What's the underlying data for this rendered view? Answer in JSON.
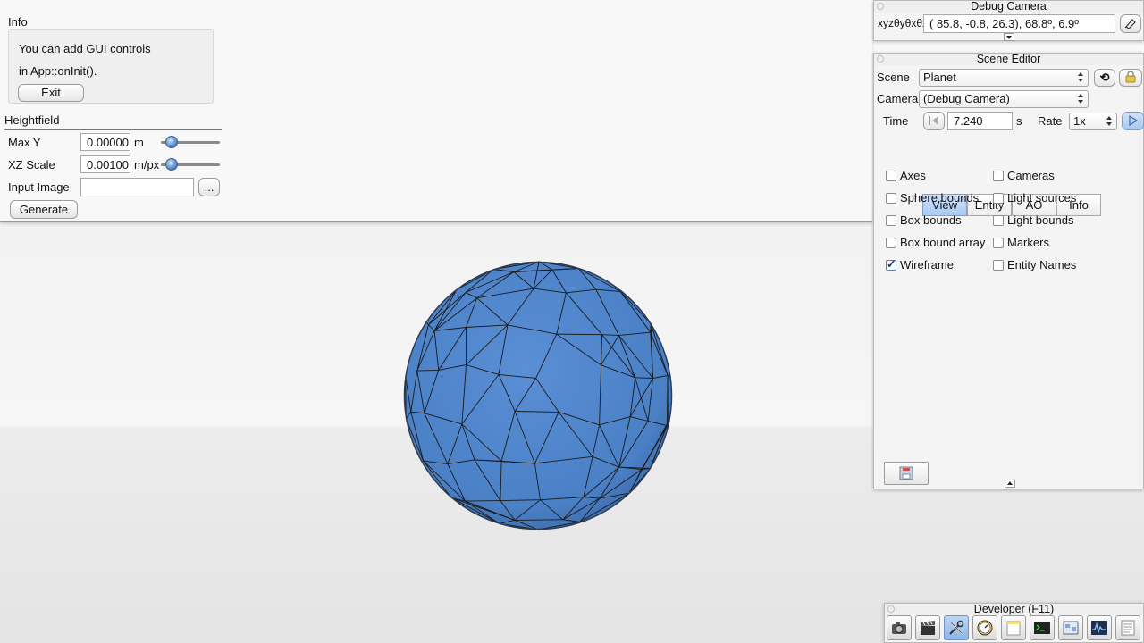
{
  "info_panel": {
    "title": "Info",
    "line1": "You can add GUI controls",
    "line2": "in App::onInit().",
    "exit_label": "Exit"
  },
  "heightfield": {
    "title": "Heightfield",
    "max_y_label": "Max Y",
    "max_y_value": "0.00000",
    "max_y_unit": "m",
    "max_y_slider_value": 0.1,
    "xz_scale_label": "XZ Scale",
    "xz_scale_value": "0.00100",
    "xz_scale_unit": "m/px",
    "xz_scale_slider_value": 0.1,
    "input_image_label": "Input Image",
    "input_image_value": "",
    "browse_label": "...",
    "generate_label": "Generate"
  },
  "debug_camera": {
    "title": "Debug Camera",
    "xyz_label": "xyzθyθxθz",
    "value": "( 85.8,  -0.8,  26.3),  68.8º,   6.9º",
    "copy_icon": "copy-icon",
    "expand_icon": "chevron-down-icon"
  },
  "scene_editor": {
    "title": "Scene Editor",
    "scene_label": "Scene",
    "scene_value": "Planet",
    "reload_icon": "reload-icon",
    "lock_icon": "lock-icon",
    "camera_label": "Camera",
    "camera_value": "(Debug Camera)",
    "time_label": "Time",
    "time_value": "7.240",
    "time_unit": "s",
    "rate_label": "Rate",
    "rate_value": "1x",
    "play_icon": "play-icon",
    "tabs": [
      {
        "label": "View",
        "active": true
      },
      {
        "label": "Entity",
        "active": false
      },
      {
        "label": "AO",
        "active": false
      },
      {
        "label": "Info",
        "active": false
      }
    ],
    "checkboxes_left": [
      {
        "label": "Axes",
        "checked": false
      },
      {
        "label": "Sphere bounds",
        "checked": false
      },
      {
        "label": "Box bounds",
        "checked": false
      },
      {
        "label": "Box bound array",
        "checked": false
      },
      {
        "label": "Wireframe",
        "checked": true
      }
    ],
    "checkboxes_right": [
      {
        "label": "Cameras",
        "checked": false
      },
      {
        "label": "Light sources",
        "checked": false
      },
      {
        "label": "Light bounds",
        "checked": false
      },
      {
        "label": "Markers",
        "checked": false
      },
      {
        "label": "Entity Names",
        "checked": false
      }
    ],
    "save_icon": "save-icon",
    "collapse_icon": "chevron-up-icon"
  },
  "developer": {
    "title": "Developer (F11)",
    "tools": [
      {
        "icon": "camera-icon",
        "active": false
      },
      {
        "icon": "film-clapper-icon",
        "active": false
      },
      {
        "icon": "wrench-screwdriver-icon",
        "active": true
      },
      {
        "icon": "gauge-icon",
        "active": false
      },
      {
        "icon": "sticky-note-icon",
        "active": false
      },
      {
        "icon": "console-icon",
        "active": false
      },
      {
        "icon": "window-layout-icon",
        "active": false
      },
      {
        "icon": "profiler-graph-icon",
        "active": false
      },
      {
        "icon": "document-icon",
        "active": false
      }
    ]
  },
  "colors": {
    "sphere_fill": "#4a80c6",
    "wire": "#1a1a1a",
    "active_blue": "#a8c9f2"
  }
}
